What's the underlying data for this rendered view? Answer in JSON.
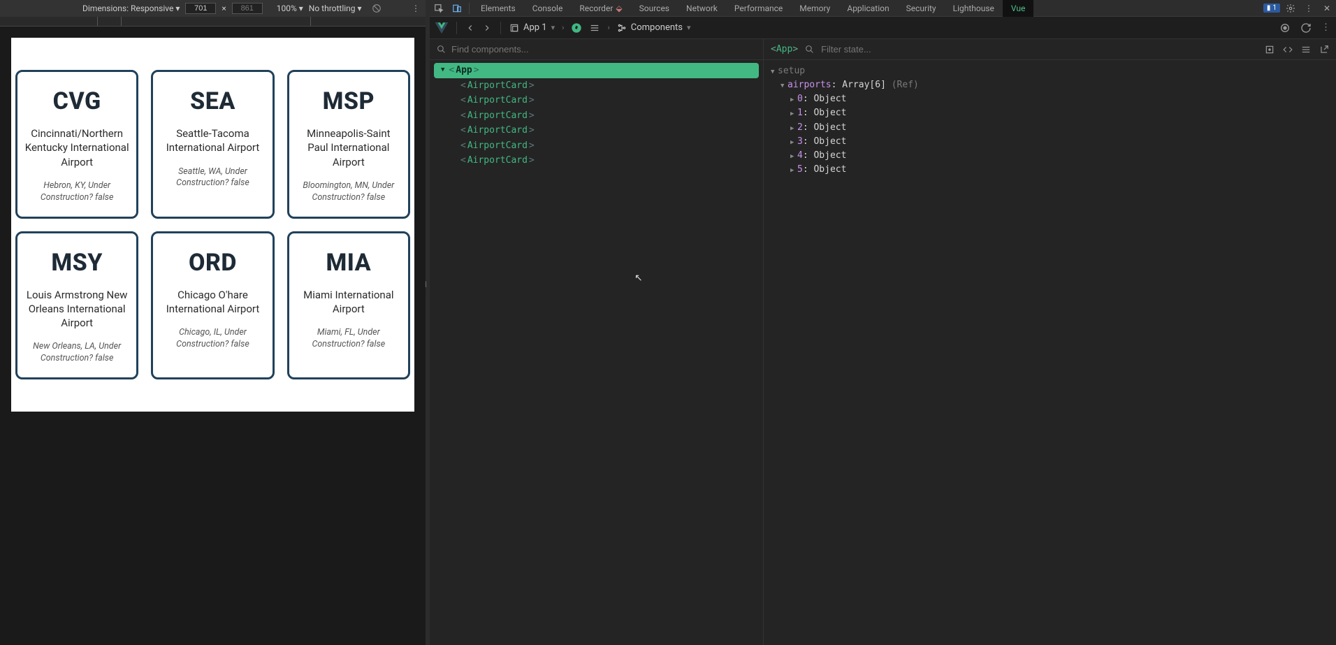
{
  "device_toolbar": {
    "dimensions_label": "Dimensions: Responsive ▾",
    "width": "701",
    "height": "861",
    "sep": "×",
    "zoom": "100% ▾",
    "throttling": "No throttling ▾"
  },
  "airports": [
    {
      "code": "CVG",
      "name": "Cincinnati/Northern Kentucky International Airport",
      "meta": "Hebron, KY, Under Construction? false"
    },
    {
      "code": "SEA",
      "name": "Seattle-Tacoma International Airport",
      "meta": "Seattle, WA, Under Construction? false"
    },
    {
      "code": "MSP",
      "name": "Minneapolis-Saint Paul International Airport",
      "meta": "Bloomington, MN, Under Construction? false"
    },
    {
      "code": "MSY",
      "name": "Louis Armstrong New Orleans International Airport",
      "meta": "New Orleans, LA, Under Construction? false"
    },
    {
      "code": "ORD",
      "name": "Chicago O'hare International Airport",
      "meta": "Chicago, IL, Under Construction? false"
    },
    {
      "code": "MIA",
      "name": "Miami International Airport",
      "meta": "Miami, FL, Under Construction? false"
    }
  ],
  "devtools_tabs": {
    "elements": "Elements",
    "console": "Console",
    "recorder": "Recorder",
    "sources": "Sources",
    "network": "Network",
    "performance": "Performance",
    "memory": "Memory",
    "application": "Application",
    "security": "Security",
    "lighthouse": "Lighthouse",
    "vue": "Vue",
    "badge": "1"
  },
  "vue_toolbar": {
    "app_label": "App 1",
    "components": "Components"
  },
  "tree": {
    "search_placeholder": "Find components...",
    "root": "App",
    "child": "AirportCard",
    "children_count": 6
  },
  "state": {
    "crumb": "App",
    "filter_placeholder": "Filter state...",
    "setup": "setup",
    "airports_key": "airports",
    "airports_type": "Array[6]",
    "airports_annot": "(Ref)",
    "items": [
      {
        "idx": "0",
        "val": "Object"
      },
      {
        "idx": "1",
        "val": "Object"
      },
      {
        "idx": "2",
        "val": "Object"
      },
      {
        "idx": "3",
        "val": "Object"
      },
      {
        "idx": "4",
        "val": "Object"
      },
      {
        "idx": "5",
        "val": "Object"
      }
    ]
  }
}
